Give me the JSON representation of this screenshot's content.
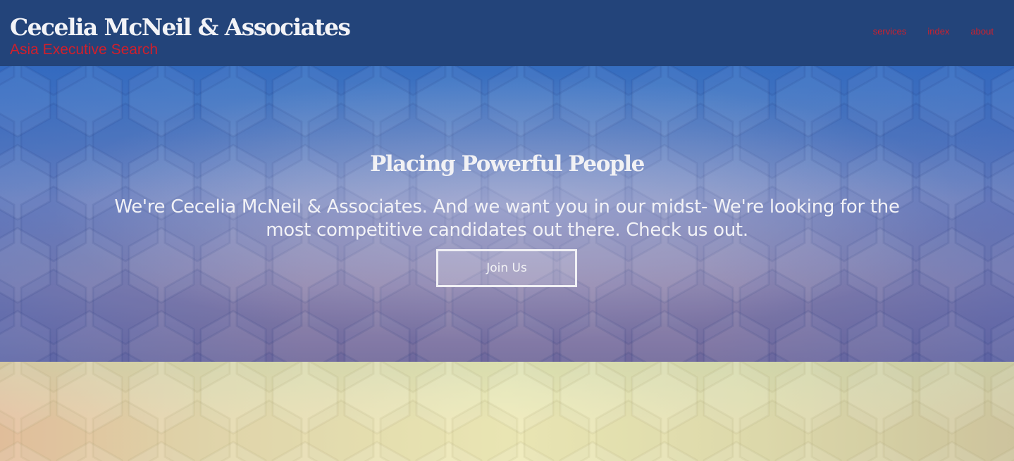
{
  "header": {
    "title": "Cecelia McNeil & Associates",
    "tagline": "Asia Executive Search",
    "nav": [
      {
        "label": "services"
      },
      {
        "label": "index"
      },
      {
        "label": "about"
      }
    ]
  },
  "hero": {
    "heading": "Placing Powerful People",
    "text": "We're Cecelia McNeil & Associates. And we want you in our midst- We're looking for the most competitive candidates out there. Check us out.",
    "button_label": "Join Us"
  },
  "colors": {
    "header_bg": "#23447a",
    "accent_red": "#d21f2b",
    "hero_top": "#4a7cbd",
    "hero_bottom": "#746b9c",
    "lower_band": "#eeeab8"
  }
}
